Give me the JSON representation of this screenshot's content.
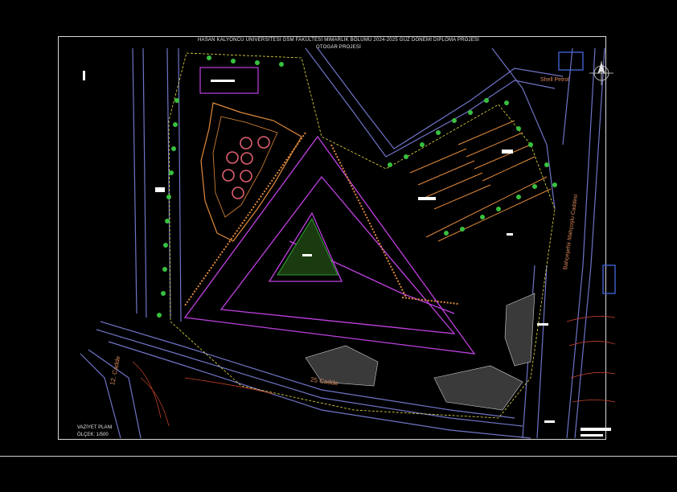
{
  "title": {
    "line1": "HASAN KALYONCU ÜNİVERSİTESİ GSM FAKÜLTESİ MİMARLIK BÖLÜMÜ 2024-2025 GÜZ DÖNEMİ DİPLOMA PROJESİ",
    "line2": "OTOGAR PROJESİ"
  },
  "labels": {
    "street_25": "25 Cadde",
    "street_12": "12. Cadde",
    "boulevard": "Bahçeşehir Mahçoşlu Caddesi",
    "shell": "Shell Petrol"
  },
  "legend": {
    "line1": "VAZİYET PLANI",
    "line2": "ÖLÇEK: 1/500"
  },
  "colors": {
    "background": "#000000",
    "road": "#6f74c6",
    "building": "#c040e0",
    "orange": "#e08a3c",
    "tree": "#38c040",
    "boundary": "#e8e040"
  }
}
